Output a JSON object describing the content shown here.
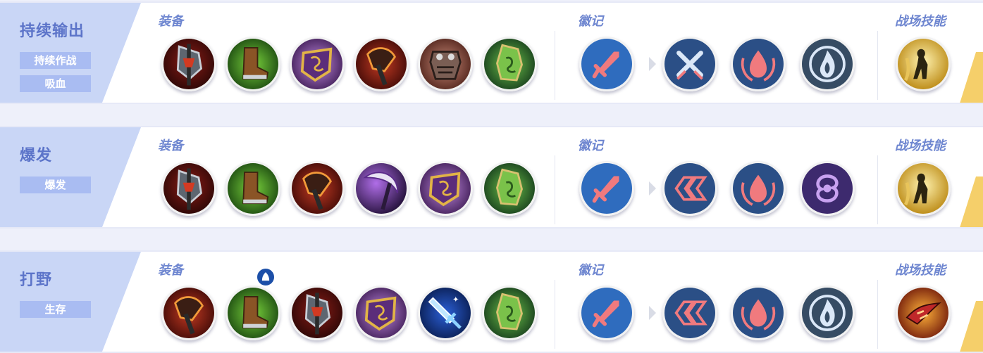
{
  "colors": {
    "panel": "#c9d6f6",
    "title": "#5c74c9",
    "tag": "#a9bcf2",
    "section": "#6e86d0",
    "emblem_blue": "#2f6cbe",
    "emblem_dark": "#2b4f86",
    "emblem_pink": "#f07a7e",
    "accent_gold": "#f5cf6a"
  },
  "sections": {
    "equipment": "装备",
    "emblem": "徽记",
    "skill": "战场技能"
  },
  "builds": [
    {
      "title": "持续输出",
      "tags": [
        "持续作战",
        "吸血"
      ],
      "items": [
        "axe-icon",
        "boots-icon",
        "shield-icon",
        "cleaver-icon",
        "armor-icon",
        "cloak-icon"
      ],
      "emblems": [
        "sword-emblem-icon",
        "crossed-swords-emblem-icon",
        "blood-drop-emblem-icon",
        "flame-emblem-icon"
      ],
      "skill": "runner-skill-icon"
    },
    {
      "title": "爆发",
      "tags": [
        "爆发"
      ],
      "items": [
        "axe-icon",
        "boots-icon",
        "cleaver-icon",
        "scythe-icon",
        "shield-icon",
        "cloak-icon"
      ],
      "emblems": [
        "sword-emblem-icon",
        "chevrons-emblem-icon",
        "blood-drop-emblem-icon",
        "vortex-emblem-icon"
      ],
      "skill": "runner-skill-icon"
    },
    {
      "title": "打野",
      "tags": [
        "生存"
      ],
      "items": [
        "cleaver-icon",
        "jungle-boots-icon",
        "axe-icon",
        "shield-icon",
        "ice-blade-icon",
        "cloak-icon"
      ],
      "emblems": [
        "sword-emblem-icon",
        "chevrons-emblem-icon",
        "blood-drop-emblem-icon",
        "flame-emblem-icon"
      ],
      "skill": "dragon-claw-skill-icon"
    }
  ]
}
